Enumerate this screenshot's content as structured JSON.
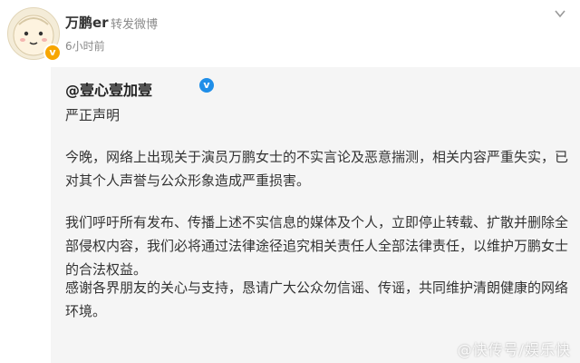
{
  "post": {
    "username": "万鹏er",
    "repost_tag": "转发微博",
    "time": "6小时前",
    "more_icon": "chevron-down-icon"
  },
  "repost": {
    "author": "@壹心壹加壹",
    "verified_icon": "verified-icon",
    "paragraphs": [
      "严正声明",
      "今晚，网络上出现关于演员万鹏女士的不实言论及恶意揣测，相关内容严重失实，已对其个人声誉与公众形象造成严重损害。",
      "我们呼吁所有发布、传播上述不实信息的媒体及个人，立即停止转载、扩散并删除全部侵权内容，我们必将通过法律途径追究相关责任人全部法律责任，以维护万鹏女士的合法权益。",
      "感谢各界朋友的关心与支持，恳请广大公众勿信谣、传谣，共同维护清朗健康的网络环境。"
    ]
  },
  "watermark": "@快传号/娱乐快",
  "colors": {
    "card_bg": "#f5f5f5",
    "badge_orange": "#f7a600",
    "verified_blue": "#1f8ee8"
  }
}
